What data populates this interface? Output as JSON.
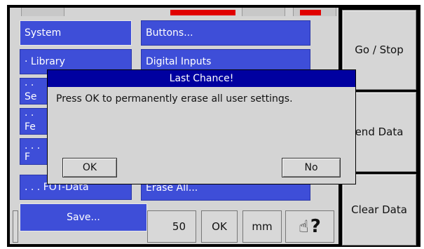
{
  "menu": {
    "left": [
      "System",
      "· Library",
      "· · Se",
      "· · Fe",
      ". . . F",
      ". . . FOT-Data",
      "Save..."
    ],
    "right": [
      "Buttons...",
      "Digital Inputs",
      "Erase All..."
    ]
  },
  "side_buttons": {
    "go_stop": "Go / Stop",
    "send_data": "end Data",
    "clear_data": "Clear Data"
  },
  "bottom_bar": {
    "value": "50",
    "ok": "OK",
    "unit": "mm"
  },
  "dialog": {
    "title": "Last Chance!",
    "message": "Press OK to permanently erase all user settings.",
    "ok_label": "OK",
    "no_label": "No"
  },
  "colors": {
    "menu_blue": "#3e4ed8",
    "title_blue": "#0000a0",
    "alert_red": "#e00000"
  }
}
